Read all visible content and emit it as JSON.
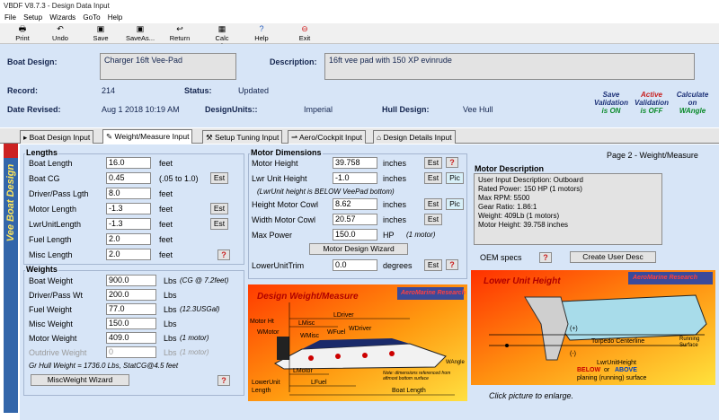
{
  "window": {
    "title": "VBDF V8.7.3 - Design Data Input"
  },
  "menu": [
    "File",
    "Setup",
    "Wizards",
    "GoTo",
    "Help"
  ],
  "toolbar": [
    "Print",
    "Undo",
    "Save",
    "SaveAs...",
    "Return",
    "Calc Perform",
    "Help",
    "Exit"
  ],
  "header": {
    "boat_design_label": "Boat Design:",
    "boat_design": "Charger 16ft Vee-Pad",
    "description_label": "Description:",
    "description": "16ft vee pad with 150 XP evinrude",
    "record_label": "Record:",
    "record": "214",
    "status_label": "Status:",
    "status": "Updated",
    "date_label": "Date Revised:",
    "date": "Aug 1 2018 10:19 AM",
    "units_label": "DesignUnits::",
    "units": "Imperial",
    "hull_label": "Hull Design:",
    "hull": "Vee Hull",
    "badges": [
      {
        "top": "Save",
        "mid": "Validation",
        "bot": "is ON"
      },
      {
        "top": "Active",
        "mid": "Validation",
        "bot": "is OFF"
      },
      {
        "top": "Calculate",
        "mid": "on",
        "bot": "WAngle"
      }
    ]
  },
  "tabs": [
    "Boat Design Input",
    "Weight/Measure Input",
    "Setup Tuning Input",
    "Aero/Cockpit Input",
    "Design Details Input"
  ],
  "sidebar_title": "Vee Boat Design",
  "page_label": "Page 2 - Weight/Measure",
  "lengths": {
    "title": "Lengths",
    "rows": [
      {
        "label": "Boat Length",
        "value": "16.0",
        "unit": "feet"
      },
      {
        "label": "Boat CG",
        "value": "0.45",
        "unit": "(.05 to 1.0)"
      },
      {
        "label": "Driver/Pass Lgth",
        "value": "8.0",
        "unit": "feet"
      },
      {
        "label": "Motor Length",
        "value": "-1.3",
        "unit": "feet"
      },
      {
        "label": "LwrUnitLength",
        "value": "-1.3",
        "unit": "feet"
      },
      {
        "label": "Fuel Length",
        "value": "2.0",
        "unit": "feet"
      },
      {
        "label": "Misc Length",
        "value": "2.0",
        "unit": "feet"
      }
    ],
    "est": "Est"
  },
  "weights": {
    "title": "Weights",
    "rows": [
      {
        "label": "Boat Weight",
        "value": "900.0",
        "unit": "Lbs",
        "note": "(CG @ 7.2feet)"
      },
      {
        "label": "Driver/Pass Wt",
        "value": "200.0",
        "unit": "Lbs",
        "note": ""
      },
      {
        "label": "Fuel Weight",
        "value": "77.0",
        "unit": "Lbs",
        "note": "(12.3USGal)"
      },
      {
        "label": "Misc Weight",
        "value": "150.0",
        "unit": "Lbs",
        "note": ""
      },
      {
        "label": "Motor Weight",
        "value": "409.0",
        "unit": "Lbs",
        "note": "(1 motor)"
      },
      {
        "label": "Outdrive Weight",
        "value": "0",
        "unit": "Lbs",
        "note": "(1 motor)"
      }
    ],
    "gross": "Gr Hull Weight = 1736.0 Lbs, StatCG@4.5 feet",
    "wizard": "MiscWeight Wizard"
  },
  "motor": {
    "title": "Motor Dimensions",
    "rows": [
      {
        "label": "Motor Height",
        "value": "39.758",
        "unit": "inches"
      },
      {
        "label": "Lwr Unit Height",
        "value": "-1.0",
        "unit": "inches"
      },
      {
        "label": "Height Motor Cowl",
        "value": "8.62",
        "unit": "inches"
      },
      {
        "label": "Width Motor Cowl",
        "value": "20.57",
        "unit": "inches"
      },
      {
        "label": "Max Power",
        "value": "150.0",
        "unit": "HP"
      }
    ],
    "lwr_note": "(LwrUnit height is BELOW VeePad bottom)",
    "power_note": "(1 motor)",
    "wizard": "Motor Design Wizard",
    "trim_label": "LowerUnitTrim",
    "trim_value": "0.0",
    "trim_unit": "degrees",
    "pic": "Pic"
  },
  "desc": {
    "title": "Motor Description",
    "lines": [
      "User Input Description: Outboard",
      "Rated Power: 150 HP (1 motors)",
      "Max RPM: 5500",
      "Gear Ratio: 1.86:1",
      "Weight: 409Lb (1 motors)",
      "Motor Height: 39.758 inches"
    ],
    "oem": "OEM specs",
    "create": "Create User Desc"
  },
  "pic1": {
    "title": "Design Weight/Measure",
    "brand": "AeroMarine Research",
    "labels": [
      "LDriver",
      "LMisc",
      "Motor Ht",
      "WMotor",
      "WMisc",
      "WFuel",
      "WDriver",
      "LMotor",
      "LowerUnit",
      "Length",
      "LFuel",
      "Boat Length",
      "WAngle"
    ],
    "note": "Note: dimensions referenced from aftmost bottom surface"
  },
  "pic2": {
    "title": "Lower Unit Height",
    "brand": "AeroMarine Research",
    "labels": [
      "(+)",
      "(-)",
      "Torpedo Centerline",
      "Running Surface",
      "LwrUnitHeight",
      "BELOW",
      "ABOVE",
      "planing (running) surface",
      "or"
    ]
  },
  "enlarge": "Click picture to enlarge.",
  "colors": {
    "header_bg": "#d7e5f7",
    "label": "#13244e",
    "pic_bg": "#ff8c14",
    "help_red": "#c81e1e"
  }
}
